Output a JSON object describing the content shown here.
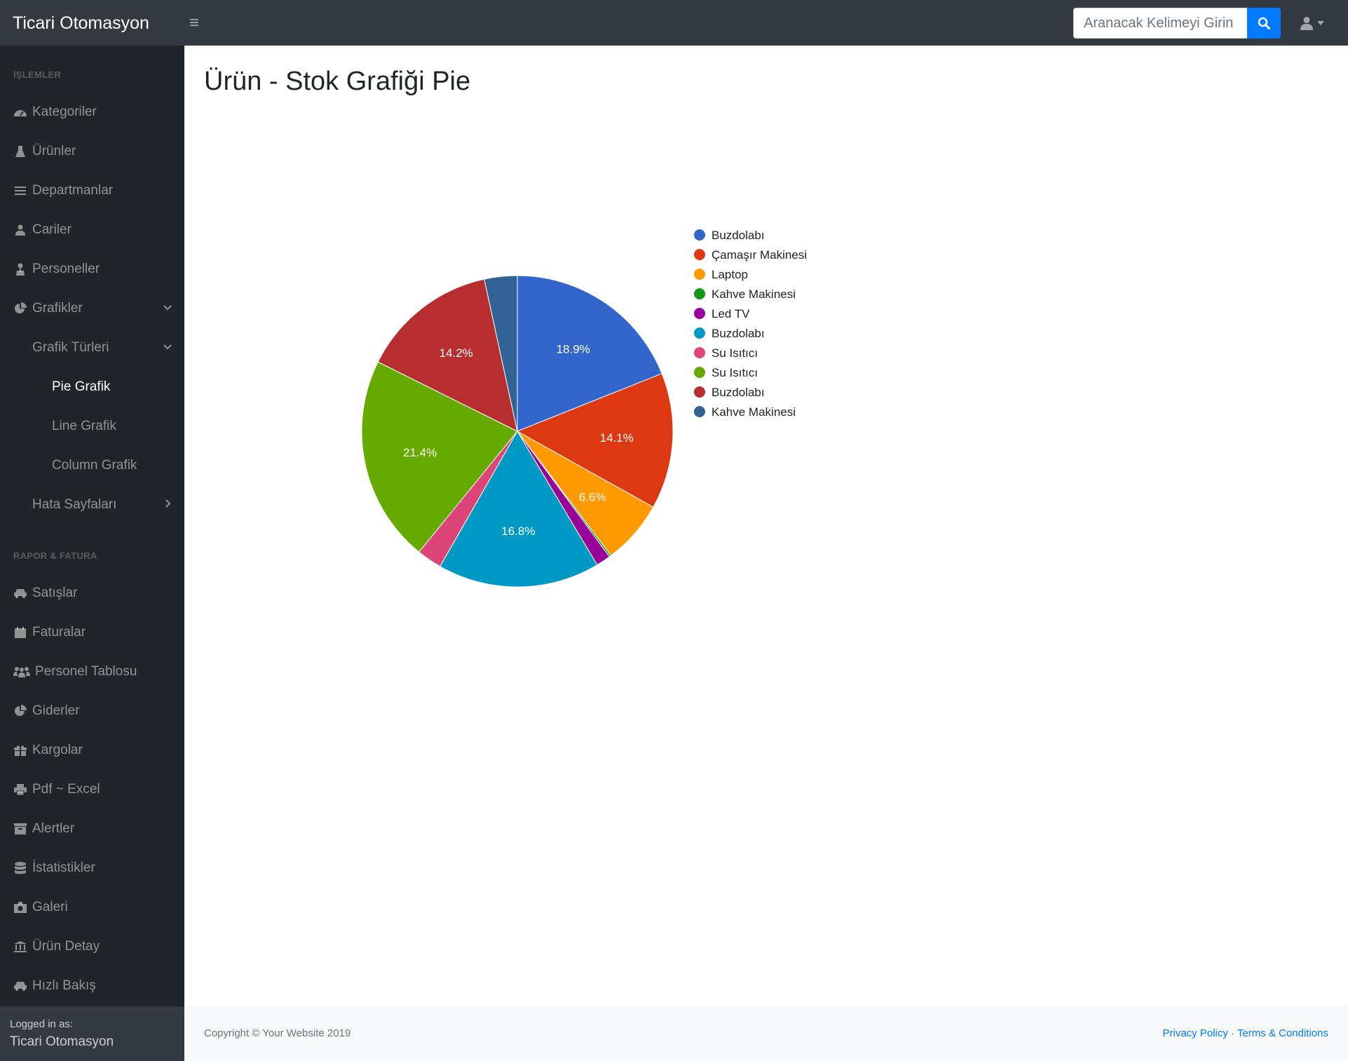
{
  "navbar": {
    "brand": "Ticari Otomasyon",
    "search_placeholder": "Aranacak Kelimeyi Girin",
    "toggle_icon": "bars-icon",
    "search_icon": "search-icon",
    "user_icon": "user-icon"
  },
  "sidebar": {
    "heading_1": "İşlemler",
    "heading_2": "Rapor & Fatura",
    "items": [
      {
        "label": "Kategoriler",
        "icon": "tachometer-icon"
      },
      {
        "label": "Ürünler",
        "icon": "flask-icon"
      },
      {
        "label": "Departmanlar",
        "icon": "list-icon"
      },
      {
        "label": "Cariler",
        "icon": "user-icon"
      },
      {
        "label": "Personeller",
        "icon": "user-md-icon"
      },
      {
        "label": "Grafikler",
        "icon": "pie-chart-icon"
      },
      {
        "label": "Grafik Türleri"
      },
      {
        "label": "Pie Grafik"
      },
      {
        "label": "Line Grafik"
      },
      {
        "label": "Column Grafik"
      },
      {
        "label": "Hata Sayfaları"
      },
      {
        "label": "Satışlar",
        "icon": "car-icon"
      },
      {
        "label": "Faturalar",
        "icon": "calendar-icon"
      },
      {
        "label": "Personel Tablosu",
        "icon": "users-icon"
      },
      {
        "label": "Giderler",
        "icon": "pie-chart-icon"
      },
      {
        "label": "Kargolar",
        "icon": "gift-icon"
      },
      {
        "label": "Pdf ~ Excel",
        "icon": "print-icon"
      },
      {
        "label": "Alertler",
        "icon": "archive-icon"
      },
      {
        "label": "İstatistikler",
        "icon": "database-icon"
      },
      {
        "label": "Galeri",
        "icon": "camera-icon"
      },
      {
        "label": "Ürün Detay",
        "icon": "bank-icon"
      },
      {
        "label": "Hızlı Bakış",
        "icon": "car-icon"
      }
    ],
    "footer_small": "Logged in as:",
    "footer_name": "Ticari Otomasyon"
  },
  "main": {
    "title": "Ürün - Stok Grafiği Pie"
  },
  "chart_data": {
    "type": "pie",
    "title": "",
    "legend_position": "right",
    "categories": [
      "Buzdolabı",
      "Çamaşır Makinesi",
      "Laptop",
      "Kahve Makinesi",
      "Led TV",
      "Buzdolabı",
      "Su Isıtıcı",
      "Su Isıtıcı",
      "Buzdolabı",
      "Kahve Makinesi"
    ],
    "values": [
      18.9,
      14.1,
      6.6,
      0.2,
      1.5,
      16.8,
      2.6,
      21.4,
      14.2,
      3.4
    ],
    "labels": [
      "18.9%",
      "14.1%",
      "6.6%",
      "",
      "",
      "16.8%",
      "",
      "21.4%",
      "14.2%",
      ""
    ],
    "colors": [
      "#3366cc",
      "#dc3912",
      "#ff9900",
      "#109618",
      "#990099",
      "#0099c6",
      "#dd4477",
      "#66aa00",
      "#b82e2e",
      "#316395"
    ]
  },
  "footer": {
    "copyright": "Copyright © Your Website 2019",
    "privacy": "Privacy Policy",
    "separator": "·",
    "terms": "Terms & Conditions"
  }
}
